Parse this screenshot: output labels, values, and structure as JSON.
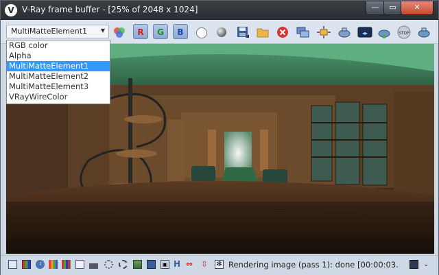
{
  "window": {
    "title": "V-Ray frame buffer - [25% of 2048 x 1024]",
    "app_icon": "vray-logo-icon",
    "controls": {
      "minimize": "—",
      "maximize": "▭",
      "close": "✕"
    }
  },
  "toolbar": {
    "channel_select": {
      "selected": "MultiMatteElement1"
    },
    "channel_buttons": {
      "red": "R",
      "green": "G",
      "blue": "B"
    },
    "icons": [
      "channel-color-icon",
      "red-channel-icon",
      "green-channel-icon",
      "blue-channel-icon",
      "white-circle-icon",
      "gray-sphere-icon",
      "save-icon",
      "open-folder-icon",
      "clear-icon",
      "duplicate-icon",
      "track-mouse-icon",
      "render-region-icon",
      "render-last-icon",
      "compare-icon",
      "render-icon",
      "stop-icon"
    ]
  },
  "dropdown": {
    "options": [
      "RGB color",
      "Alpha",
      "MultiMatteElement1",
      "MultiMatteElement2",
      "MultiMatteElement3",
      "VRayWireColor"
    ],
    "selected_index": 2
  },
  "statusbar": {
    "text": "Rendering image (pass 1): done [00:00:03.",
    "icons": [
      "toggle-panel-icon",
      "color-correction-icon",
      "info-icon",
      "levels-icon",
      "channels-icon",
      "curve-icon",
      "histogram-icon",
      "exposure-icon",
      "lens-effects-icon",
      "background-icon",
      "tile-icon",
      "lut-icon",
      "history-icon",
      "flip-h-icon",
      "settings-icon",
      "stereo-icon",
      "collapse-icon"
    ],
    "labels": {
      "h_icon": "H"
    }
  },
  "colors": {
    "title_bg": "#2f3338",
    "select_highlight": "#3399ff",
    "frame_bg": "#cfd9e6"
  }
}
